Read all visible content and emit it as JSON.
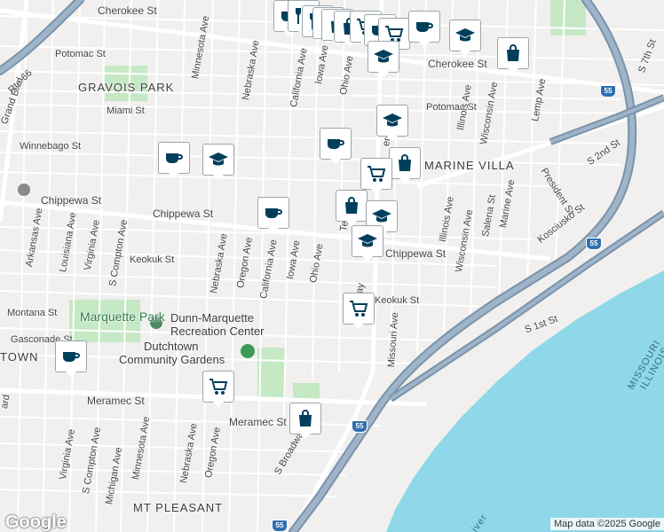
{
  "colors": {
    "water": "#8fd8e9",
    "park": "#c5e8c5",
    "road": "#ffffff",
    "highway": "#8ea6bd",
    "highway_outline": "#7a93ab",
    "land": "#f1f0ee",
    "marker": "#003f5c"
  },
  "streets": [
    {
      "name": "Cherokee St",
      "key": "cherokee_w"
    },
    {
      "name": "Cherokee St",
      "key": "cherokee_e"
    },
    {
      "name": "Potomac St",
      "key": "potomac_w"
    },
    {
      "name": "Potomac St",
      "key": "potomac_e"
    },
    {
      "name": "Miami St",
      "key": "miami"
    },
    {
      "name": "Winnebago St",
      "key": "winnebago"
    },
    {
      "name": "Chippewa St",
      "key": "chippewa_w"
    },
    {
      "name": "Chippewa St",
      "key": "chippewa_c"
    },
    {
      "name": "Chippewa St",
      "key": "chippewa_e"
    },
    {
      "name": "Keokuk St",
      "key": "keokuk_w"
    },
    {
      "name": "Keokuk St",
      "key": "keokuk_e"
    },
    {
      "name": "Montana St",
      "key": "montana"
    },
    {
      "name": "Gasconade St",
      "key": "gasconade"
    },
    {
      "name": "Meramec St",
      "key": "meramec_w"
    },
    {
      "name": "Meramec St",
      "key": "meramec_e"
    },
    {
      "name": "Grand Blvd",
      "key": "grand"
    },
    {
      "name": "Minnesota Ave",
      "key": "minnesota_n"
    },
    {
      "name": "Nebraska Ave",
      "key": "nebraska_n"
    },
    {
      "name": "California Ave",
      "key": "california_n"
    },
    {
      "name": "Iowa Ave",
      "key": "iowa_n"
    },
    {
      "name": "Ohio Ave",
      "key": "ohio_n"
    },
    {
      "name": "Illinois Ave",
      "key": "illinois_n"
    },
    {
      "name": "Wisconsin Ave",
      "key": "wisconsin_n"
    },
    {
      "name": "Lemp Ave",
      "key": "lemp"
    },
    {
      "name": "S 7th St",
      "key": "s7th"
    },
    {
      "name": "S 2nd St",
      "key": "s2nd"
    },
    {
      "name": "President St",
      "key": "president"
    },
    {
      "name": "Kosciusko St",
      "key": "kosciusko"
    },
    {
      "name": "Arkansas Ave",
      "key": "arkansas"
    },
    {
      "name": "Louisiana Ave",
      "key": "louisiana"
    },
    {
      "name": "Virginia Ave",
      "key": "virginia_n"
    },
    {
      "name": "S Compton Ave",
      "key": "compton_n"
    },
    {
      "name": "Nebraska Ave",
      "key": "nebraska_c"
    },
    {
      "name": "Oregon Ave",
      "key": "oregon_c"
    },
    {
      "name": "California Ave",
      "key": "california_c"
    },
    {
      "name": "Iowa Ave",
      "key": "iowa_c"
    },
    {
      "name": "Ohio Ave",
      "key": "ohio_c"
    },
    {
      "name": "Illinois Ave",
      "key": "illinois_c"
    },
    {
      "name": "Wisconsin Ave",
      "key": "wisconsin_c"
    },
    {
      "name": "Salena St",
      "key": "salena"
    },
    {
      "name": "Marine Ave",
      "key": "marine"
    },
    {
      "name": "Missouri Ave",
      "key": "missouri"
    },
    {
      "name": "S 1st St",
      "key": "s1st"
    },
    {
      "name": "Virginia Ave",
      "key": "virginia_s"
    },
    {
      "name": "S Compton Ave",
      "key": "compton_s"
    },
    {
      "name": "Michigan Ave",
      "key": "michigan"
    },
    {
      "name": "Minnesota Ave",
      "key": "minnesota_s"
    },
    {
      "name": "Nebraska Ave",
      "key": "nebraska_s"
    },
    {
      "name": "Oregon Ave",
      "key": "oregon_s"
    },
    {
      "name": "S Broadway",
      "key": "broadway"
    },
    {
      "name": "Te",
      "key": "te_frag"
    },
    {
      "name": "erson",
      "key": "jefferson_frag"
    },
    {
      "name": "ay",
      "key": "ay_frag"
    },
    {
      "name": "ard",
      "key": "ard_frag"
    }
  ],
  "areas": {
    "gravois_park": "GRAVOIS PARK",
    "marine_villa": "MARINE VILLA",
    "mt_pleasant": "MT PLEASANT",
    "town_frag": "TOWN",
    "missouri_frag": "MISSOURI",
    "illinois_frag": "ILLINOIS",
    "rte66_frag": "Rte 66",
    "river_frag": "iver"
  },
  "places": {
    "marquette_park": "Marquette Park",
    "dunn_marquette_1": "Dunn-Marquette",
    "dunn_marquette_2": "Recreation Center",
    "dutchtown_1": "Dutchtown",
    "dutchtown_2": "Community Gardens"
  },
  "highway_shields": [
    "55",
    "55",
    "55",
    "55"
  ],
  "markers": [
    {
      "icon": "coffee-icon",
      "kind": "cafe"
    },
    {
      "icon": "restaurant-icon",
      "kind": "restaurant"
    },
    {
      "icon": "restaurant-icon",
      "kind": "restaurant"
    },
    {
      "icon": "shopping-bag-icon",
      "kind": "store"
    },
    {
      "icon": "shopping-bag-icon",
      "kind": "store"
    },
    {
      "icon": "shopping-bag-icon",
      "kind": "store"
    },
    {
      "icon": "shopping-cart-icon",
      "kind": "grocery"
    },
    {
      "icon": "coffee-icon",
      "kind": "cafe"
    },
    {
      "icon": "shopping-cart-icon",
      "kind": "grocery"
    },
    {
      "icon": "coffee-icon",
      "kind": "cafe"
    },
    {
      "icon": "graduation-cap-icon",
      "kind": "school"
    },
    {
      "icon": "shopping-bag-icon",
      "kind": "store"
    },
    {
      "icon": "graduation-cap-icon",
      "kind": "school"
    },
    {
      "icon": "graduation-cap-icon",
      "kind": "school"
    },
    {
      "icon": "coffee-icon",
      "kind": "cafe"
    },
    {
      "icon": "graduation-cap-icon",
      "kind": "school"
    },
    {
      "icon": "coffee-icon",
      "kind": "cafe"
    },
    {
      "icon": "shopping-bag-icon",
      "kind": "store"
    },
    {
      "icon": "shopping-cart-icon",
      "kind": "grocery"
    },
    {
      "icon": "coffee-icon",
      "kind": "cafe"
    },
    {
      "icon": "shopping-bag-icon",
      "kind": "store"
    },
    {
      "icon": "graduation-cap-icon",
      "kind": "school"
    },
    {
      "icon": "graduation-cap-icon",
      "kind": "school"
    },
    {
      "icon": "shopping-cart-icon",
      "kind": "grocery"
    },
    {
      "icon": "coffee-icon",
      "kind": "cafe"
    },
    {
      "icon": "shopping-cart-icon",
      "kind": "grocery"
    },
    {
      "icon": "shopping-bag-icon",
      "kind": "store"
    }
  ],
  "branding": {
    "logo": "Google",
    "attribution": "Map data ©2025 Google"
  }
}
